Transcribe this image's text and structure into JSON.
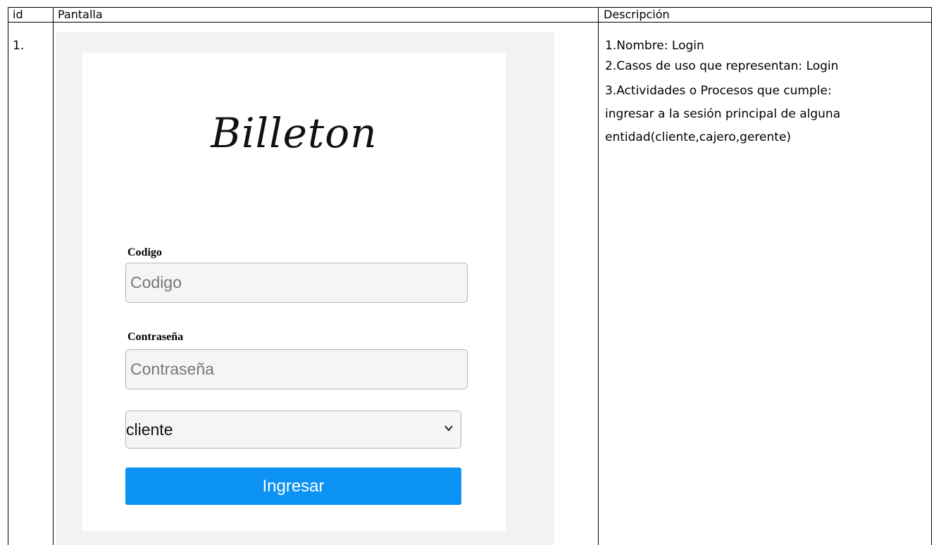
{
  "table": {
    "headers": {
      "id": "id",
      "screen": "Pantalla",
      "description": "Descripción"
    },
    "rows": [
      {
        "id": "1.",
        "description_lines": [
          "1.Nombre: Login",
          "2.Casos de uso que representan: Login",
          "3.Actividades o Procesos que cumple:",
          "ingresar a la sesión principal de alguna",
          "entidad(cliente,cajero,gerente)"
        ]
      }
    ]
  },
  "login_screen": {
    "logo_text": "Billeton",
    "code_label": "Codigo",
    "code_placeholder": "Codigo",
    "password_label": "Contraseña",
    "password_placeholder": "Contraseña",
    "role_selected": "cliente",
    "submit_label": "Ingresar",
    "colors": {
      "button_bg": "#0b92f3",
      "button_text": "#ffffff",
      "frame_bg": "#f3f3f3"
    }
  }
}
